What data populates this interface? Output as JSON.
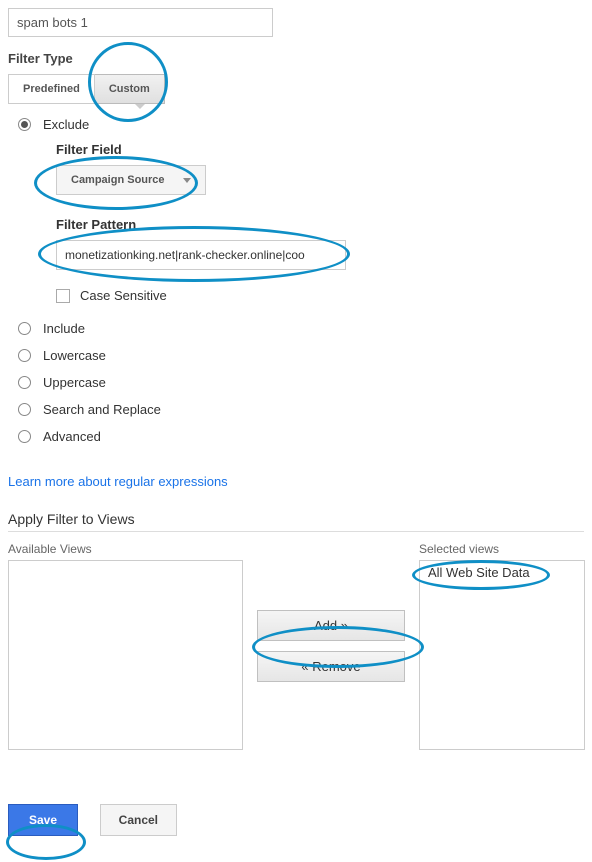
{
  "filterName": {
    "value": "spam bots 1"
  },
  "filterType": {
    "label": "Filter Type",
    "tabs": {
      "predefined": "Predefined",
      "custom": "Custom"
    }
  },
  "filterMode": {
    "exclude": "Exclude",
    "include": "Include",
    "lowercase": "Lowercase",
    "uppercase": "Uppercase",
    "searchReplace": "Search and Replace",
    "advanced": "Advanced"
  },
  "filterField": {
    "label": "Filter Field",
    "selected": "Campaign Source"
  },
  "filterPattern": {
    "label": "Filter Pattern",
    "value": "monetizationking.net|rank-checker.online|coo"
  },
  "caseSensitive": {
    "label": "Case Sensitive"
  },
  "regexLink": "Learn more about regular expressions",
  "applyFilter": {
    "label": "Apply Filter to Views",
    "availableLabel": "Available Views",
    "selectedLabel": "Selected views",
    "selectedItems": [
      "All Web Site Data"
    ],
    "addBtn": "Add »",
    "removeBtn": "« Remove"
  },
  "actions": {
    "save": "Save",
    "cancel": "Cancel"
  }
}
